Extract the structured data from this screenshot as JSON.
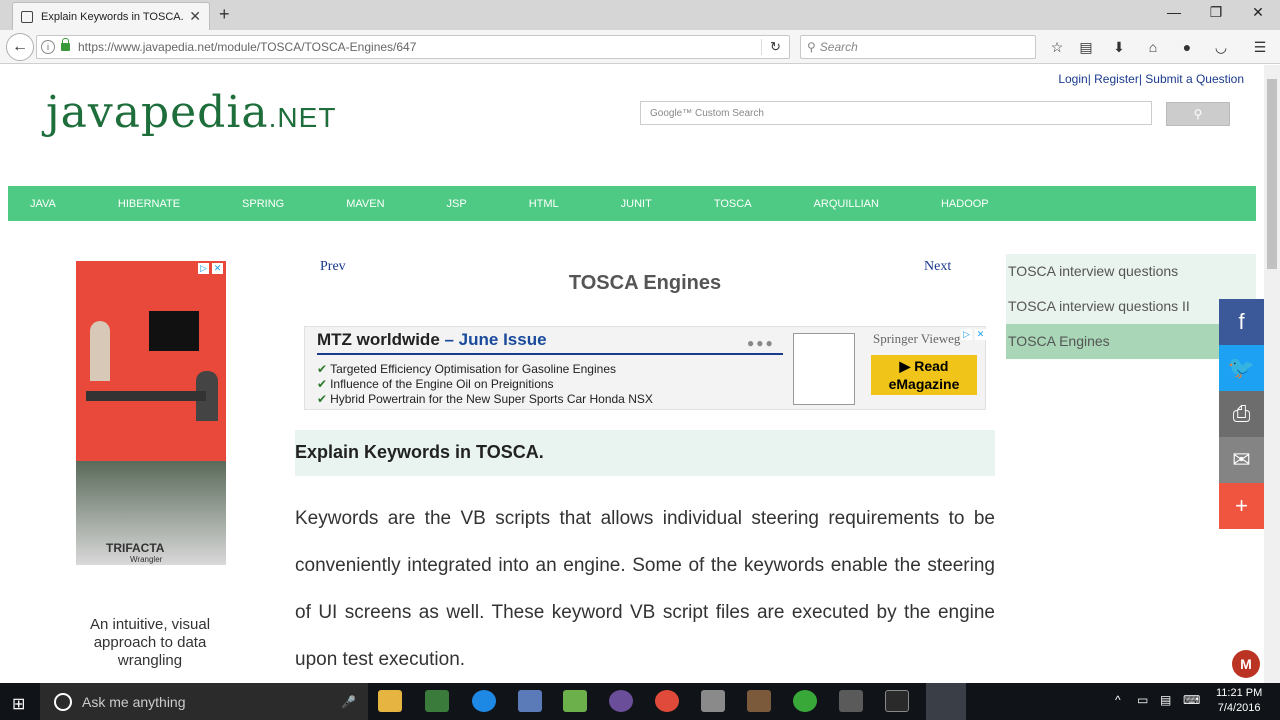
{
  "browser": {
    "tab_title": "Explain Keywords in TOSCA.",
    "tab_close": "✕",
    "new_tab": "+",
    "url": "https://www.javapedia.net/module/TOSCA/TOSCA-Engines/647",
    "search_placeholder": "Search",
    "window_buttons": [
      "—",
      "❐",
      "✕"
    ]
  },
  "site": {
    "top_links": "Login| Register| Submit a Question",
    "logo_main": "javapedia",
    "logo_suffix": ".NET",
    "google_placeholder": "Google™ Custom Search",
    "menu": [
      "JAVA",
      "HIBERNATE",
      "SPRING",
      "MAVEN",
      "JSP",
      "HTML",
      "JUNIT",
      "TOSCA",
      "ARQUILLIAN",
      "HADOOP"
    ]
  },
  "left_ad": {
    "brand": "TRIFACTA",
    "brand_sub": "Wrangler",
    "tagline": "An intuitive, visual approach to data wrangling"
  },
  "content": {
    "prev": "Prev",
    "next": "Next",
    "page_title": "TOSCA Engines",
    "question": "Explain Keywords in TOSCA.",
    "answer": "Keywords are the VB scripts that allows individual steering requirements to be conveniently integrated into an engine. Some of the keywords enable the steering of UI screens as well. These keyword VB script files are executed by the engine upon test execution."
  },
  "mid_ad": {
    "headline_a": "MTZ worldwide",
    "headline_b": " – June Issue",
    "items": [
      "Targeted Efficiency Optimisation for Gasoline Engines",
      "Influence of the Engine Oil on Preignitions",
      "Hybrid Powertrain for the New Super Sports Car Honda NSX"
    ],
    "publisher": "Springer Vieweg",
    "cta_line1": "▶ Read",
    "cta_line2": "eMagazine"
  },
  "sidebar": {
    "items": [
      {
        "label": "TOSCA interview questions",
        "active": false
      },
      {
        "label": "TOSCA interview questions II",
        "active": false
      },
      {
        "label": "TOSCA Engines",
        "active": true
      }
    ]
  },
  "share_bar": {
    "buttons": [
      {
        "icon": "facebook-icon",
        "glyph": "f",
        "color": "#3b5998"
      },
      {
        "icon": "twitter-icon",
        "glyph": "🐦",
        "color": "#1da1f2"
      },
      {
        "icon": "print-icon",
        "glyph": "⎙",
        "color": "#6d6d6d"
      },
      {
        "icon": "email-icon",
        "glyph": "✉",
        "color": "#848484"
      },
      {
        "icon": "more-icon",
        "glyph": "+",
        "color": "#f0553f"
      }
    ]
  },
  "taskbar": {
    "search_text": "Ask me anything",
    "time": "11:21 PM",
    "date": "7/4/2016"
  },
  "colors": {
    "menu_green": "#4fca84",
    "link_blue": "#1a3a8c",
    "logo_green": "#1e6e3c"
  }
}
